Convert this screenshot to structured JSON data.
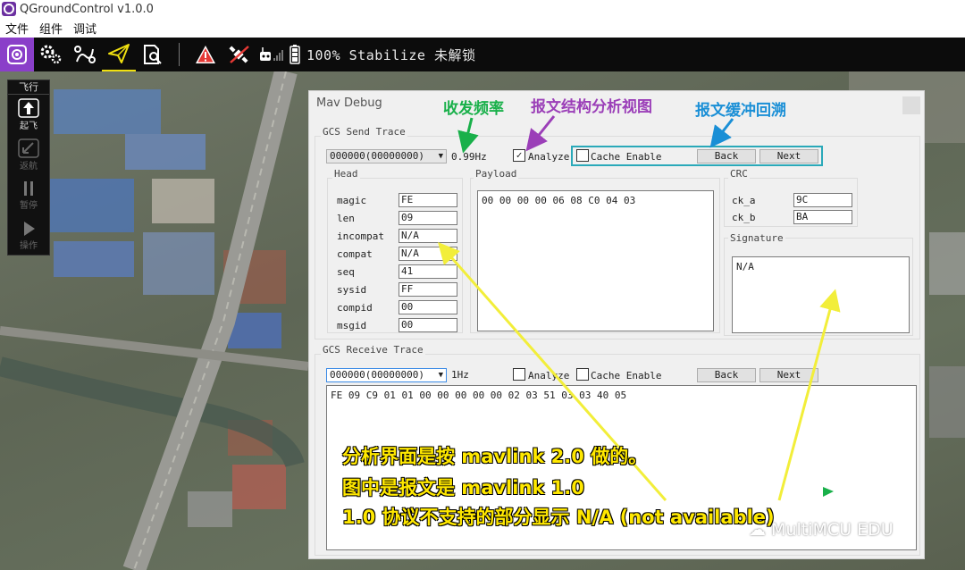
{
  "app": {
    "title": "QGroundControl v1.0.0"
  },
  "menu": {
    "items": [
      "文件",
      "组件",
      "调试"
    ]
  },
  "toolbar": {
    "status": "100% Stabilize 未解锁"
  },
  "flypanel": {
    "header": "飞行",
    "buttons": [
      "起飞",
      "返航",
      "暂停",
      "操作"
    ]
  },
  "dialog": {
    "title": "Mav Debug",
    "send": {
      "label": "GCS Send Trace",
      "combo": "000000(00000000)",
      "rate": "0.99Hz",
      "analyze_label": "Analyze",
      "analyze_checked": true,
      "cache_label": "Cache Enable",
      "back_label": "Back",
      "next_label": "Next",
      "head": {
        "label": "Head",
        "fields": [
          {
            "name": "magic",
            "value": "FE"
          },
          {
            "name": "len",
            "value": "09"
          },
          {
            "name": "incompat",
            "value": "N/A"
          },
          {
            "name": "compat",
            "value": "N/A"
          },
          {
            "name": "seq",
            "value": "41"
          },
          {
            "name": "sysid",
            "value": "FF"
          },
          {
            "name": "compid",
            "value": "00"
          },
          {
            "name": "msgid",
            "value": "00"
          }
        ]
      },
      "payload": {
        "label": "Payload",
        "value": "00 00 00 00 06 08 C0 04 03"
      },
      "crc": {
        "label": "CRC",
        "ck_a_label": "ck_a",
        "ck_a": "9C",
        "ck_b_label": "ck_b",
        "ck_b": "BA"
      },
      "signature": {
        "label": "Signature",
        "value": "N/A"
      }
    },
    "receive": {
      "label": "GCS Receive Trace",
      "combo": "000000(00000000)",
      "rate": "1Hz",
      "analyze_label": "Analyze",
      "cache_label": "Cache Enable",
      "back_label": "Back",
      "next_label": "Next",
      "data": "FE 09 C9 01 01 00 00 00 00 00 02 03 51 03 03 40 05"
    }
  },
  "annotations": {
    "rate": "收发频率",
    "analyze_view": "报文结构分析视图",
    "cache_back": "报文缓冲回溯",
    "note_line1": "分析界面是按 mavlink 2.0 做的。",
    "note_line2": "图中是报文是 mavlink 1.0",
    "note_line3": "1.0 协议不支持的部分显示 N/A (not available)",
    "arrow_color_green": "#19b04a",
    "arrow_color_purple": "#9b3fb8",
    "arrow_color_blue": "#1a8fd6",
    "arrow_color_yellow": "#f2ee3a"
  },
  "watermark": "MultiMCU EDU"
}
